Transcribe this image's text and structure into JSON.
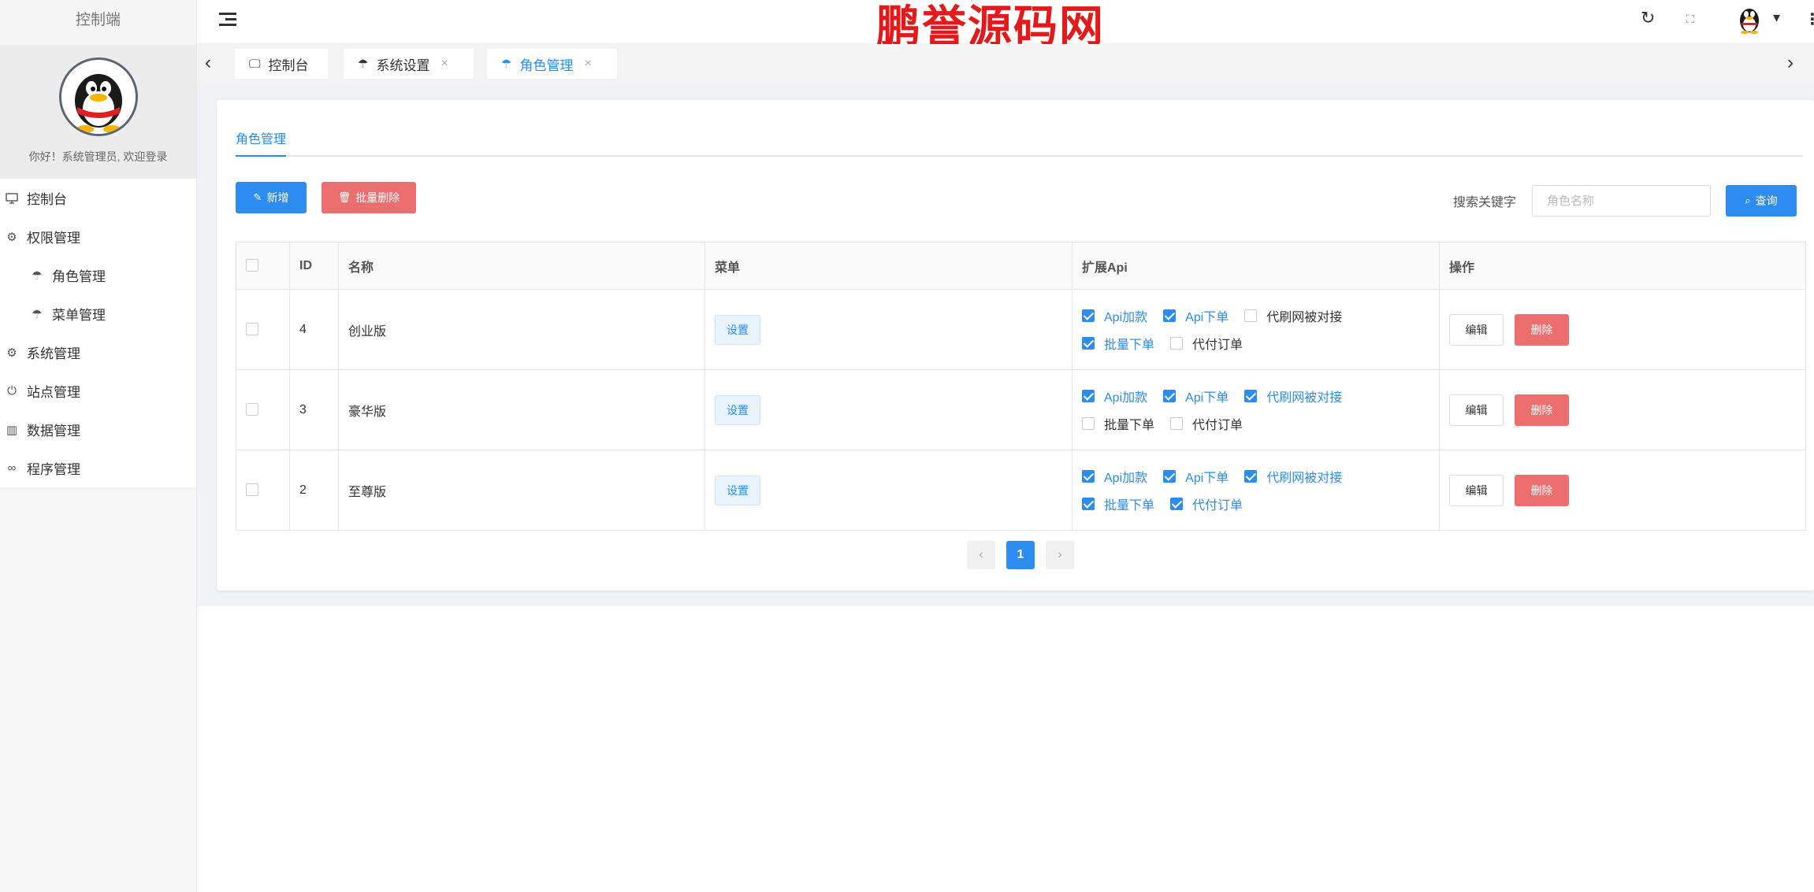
{
  "sidebar": {
    "title": "控制端",
    "welcome": "你好！系统管理员, 欢迎登录",
    "items": [
      {
        "label": "控制台",
        "icon": "monitor-icon"
      },
      {
        "label": "权限管理",
        "icon": "gear-icon"
      },
      {
        "label": "角色管理",
        "icon": "palm-icon"
      },
      {
        "label": "菜单管理",
        "icon": "palm-icon"
      },
      {
        "label": "系统管理",
        "icon": "gear-icon"
      },
      {
        "label": "站点管理",
        "icon": "power-icon"
      },
      {
        "label": "数据管理",
        "icon": "table-icon"
      },
      {
        "label": "程序管理",
        "icon": "link-icon"
      }
    ]
  },
  "header": {
    "brand": "鹏誉源码网"
  },
  "tabs": [
    {
      "label": "控制台"
    },
    {
      "label": "系统设置"
    },
    {
      "label": "角色管理"
    }
  ],
  "card": {
    "tab_label": "角色管理"
  },
  "toolbar": {
    "add_label": "新增",
    "batch_delete_label": "批量删除",
    "search_label": "搜索关键字",
    "search_placeholder": "角色名称",
    "search_value": "",
    "query_label": "查询"
  },
  "table": {
    "columns": [
      "ID",
      "名称",
      "菜单",
      "扩展Api",
      "操作"
    ],
    "set_label": "设置",
    "edit_label": "编辑",
    "delete_label": "删除",
    "rows": [
      {
        "id": "4",
        "name": "创业版",
        "apis": [
          {
            "label": "Api加款",
            "checked": true
          },
          {
            "label": "Api下单",
            "checked": true
          },
          {
            "label": "代刷网被对接",
            "checked": false
          },
          {
            "label": "批量下单",
            "checked": true
          },
          {
            "label": "代付订单",
            "checked": false
          }
        ]
      },
      {
        "id": "3",
        "name": "豪华版",
        "apis": [
          {
            "label": "Api加款",
            "checked": true
          },
          {
            "label": "Api下单",
            "checked": true
          },
          {
            "label": "代刷网被对接",
            "checked": true
          },
          {
            "label": "批量下单",
            "checked": false
          },
          {
            "label": "代付订单",
            "checked": false
          }
        ]
      },
      {
        "id": "2",
        "name": "至尊版",
        "apis": [
          {
            "label": "Api加款",
            "checked": true
          },
          {
            "label": "Api下单",
            "checked": true
          },
          {
            "label": "代刷网被对接",
            "checked": true
          },
          {
            "label": "批量下单",
            "checked": true
          },
          {
            "label": "代付订单",
            "checked": true
          }
        ]
      }
    ]
  },
  "pagination": {
    "current": "1"
  },
  "colors": {
    "primary": "#2d8cf0",
    "danger": "#ed6e6e",
    "brand": "#e51919"
  }
}
